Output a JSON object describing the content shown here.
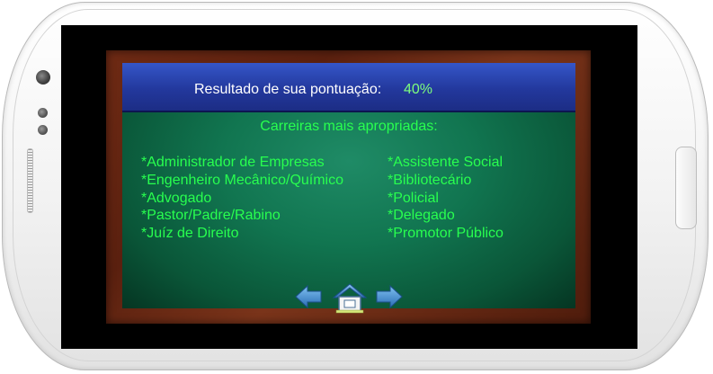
{
  "result": {
    "label": "Resultado de sua pontuação:",
    "value": "40%"
  },
  "careers": {
    "title": "Carreiras mais apropriadas:",
    "left": [
      "*Administrador de Empresas",
      "*Engenheiro Mecânico/Químico",
      "*Advogado",
      "*Pastor/Padre/Rabino",
      "*Juíz de Direito"
    ],
    "right": [
      "*Assistente Social",
      "*Bibliotecário",
      "*Policial",
      "*Delegado",
      "*Promotor Público"
    ]
  },
  "nav": {
    "back_icon": "arrow-left-icon",
    "home_icon": "home-icon",
    "forward_icon": "arrow-right-icon"
  },
  "colors": {
    "header": "#23389d",
    "board": "#117550",
    "text_green": "#28ff4f",
    "score_green": "#7dff7d",
    "frame": "#6e2a14",
    "arrow_blue": "#3f8fd6"
  }
}
